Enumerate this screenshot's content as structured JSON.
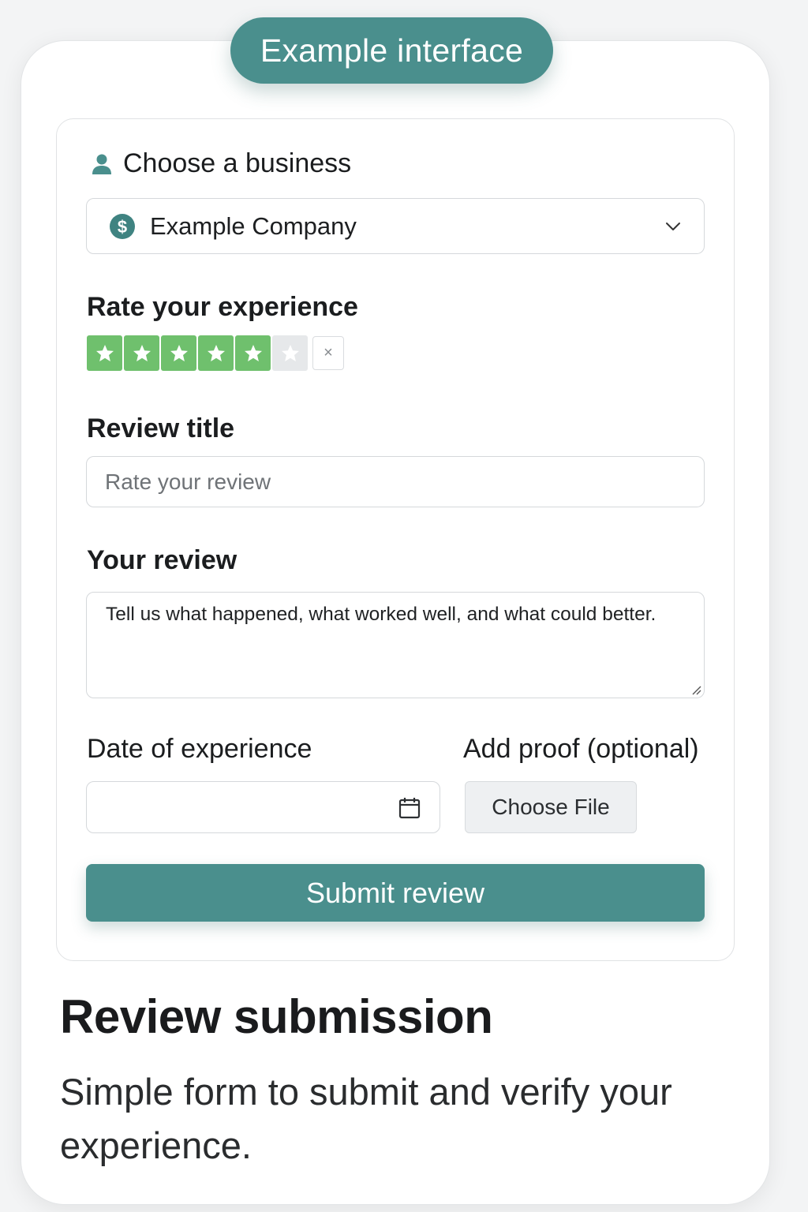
{
  "badge": {
    "label": "Example interface"
  },
  "form": {
    "business": {
      "label": "Choose a business",
      "selected": "Example Company",
      "icon": "user-icon",
      "option_icon": "coin-icon"
    },
    "rating": {
      "label": "Rate your experience",
      "value": 5,
      "max": 6,
      "clear_label": "×"
    },
    "review_title": {
      "label": "Review title",
      "placeholder": "Rate your review"
    },
    "review_body": {
      "label": "Your review",
      "placeholder": "Tell us what happened, what worked well, and what could better."
    },
    "date": {
      "label": "Date of experience",
      "value": "",
      "icon": "calendar-icon"
    },
    "proof": {
      "label": "Add proof (optional)",
      "button_label": "Choose File"
    },
    "submit_label": "Submit review"
  },
  "footer": {
    "heading": "Review submission",
    "description": "Simple form to submit and verify your experience."
  },
  "colors": {
    "accent": "#4a8f8d",
    "star_filled": "#6fc06d",
    "star_empty": "#e6e8ea"
  }
}
